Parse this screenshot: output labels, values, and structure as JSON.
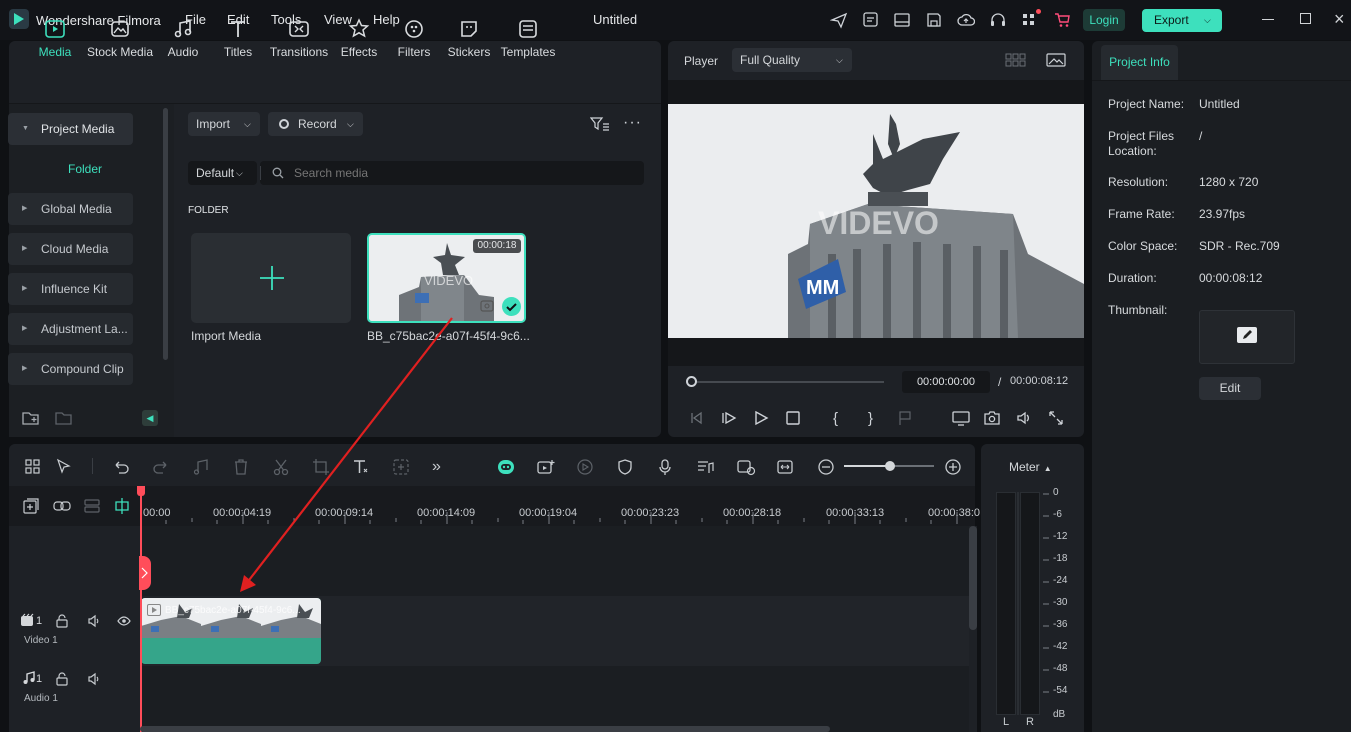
{
  "app": {
    "name": "Wondershare Filmora",
    "window_title": "Untitled"
  },
  "menu": [
    "File",
    "Edit",
    "Tools",
    "View",
    "Help"
  ],
  "top_buttons": {
    "login": "Login",
    "export": "Export"
  },
  "toolbar": [
    "Media",
    "Stock Media",
    "Audio",
    "Titles",
    "Transitions",
    "Effects",
    "Filters",
    "Stickers",
    "Templates"
  ],
  "sidebar": {
    "project_media": "Project Media",
    "folder": "Folder",
    "items": [
      "Global Media",
      "Cloud Media",
      "Influence Kit",
      "Adjustment La...",
      "Compound Clip"
    ]
  },
  "media": {
    "import": "Import",
    "record": "Record",
    "sort": "Default",
    "search_placeholder": "Search media",
    "folder_label": "FOLDER",
    "import_media": "Import Media",
    "clip_name": "BB_c75bac2e-a07f-45f4-9c6...",
    "clip_duration": "00:00:18"
  },
  "player": {
    "label": "Player",
    "quality": "Full Quality",
    "current_time": "00:00:00:00",
    "separator": "/",
    "total_time": "00:00:08:12",
    "watermark": "VIDEVO"
  },
  "project_info": {
    "tab": "Project Info",
    "rows": [
      {
        "label": "Project Name:",
        "value": "Untitled"
      },
      {
        "label": "Project Files Location:",
        "value": "/"
      },
      {
        "label": "Resolution:",
        "value": "1280 x 720"
      },
      {
        "label": "Frame Rate:",
        "value": "23.97fps"
      },
      {
        "label": "Color Space:",
        "value": "SDR - Rec.709"
      },
      {
        "label": "Duration:",
        "value": "00:00:08:12"
      },
      {
        "label": "Thumbnail:",
        "value": ""
      }
    ],
    "edit": "Edit"
  },
  "timeline": {
    "ruler": [
      "00:00",
      "00:00:04:19",
      "00:00:09:14",
      "00:00:14:09",
      "00:00:19:04",
      "00:00:23:23",
      "00:00:28:18",
      "00:00:33:13",
      "00:00:38:0"
    ],
    "tracks": [
      {
        "num": "1",
        "name": "Video 1"
      },
      {
        "num": "1",
        "name": "Audio 1"
      }
    ],
    "clip_label": "BB_c75bac2e-a07f-45f4-9c6..."
  },
  "meter": {
    "title": "Meter",
    "scale": [
      "0",
      "-6",
      "-12",
      "-18",
      "-24",
      "-30",
      "-36",
      "-42",
      "-48",
      "-54",
      "dB"
    ],
    "left": "L",
    "right": "R"
  },
  "colors": {
    "accent": "#3de0bd",
    "playhead": "#ff4d5a",
    "arrow": "#e02020"
  }
}
